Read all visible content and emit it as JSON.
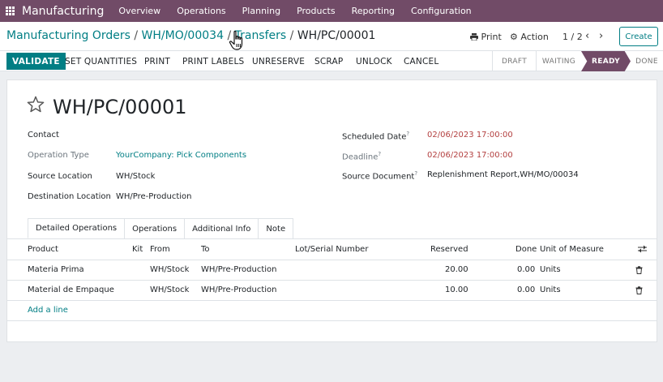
{
  "navbar": {
    "brand": "Manufacturing",
    "menu": [
      "Overview",
      "Operations",
      "Planning",
      "Products",
      "Reporting",
      "Configuration"
    ]
  },
  "breadcrumb": {
    "items": [
      "Manufacturing Orders",
      "WH/MO/00034",
      "Transfers"
    ],
    "current": "WH/PC/00001",
    "separator": "/"
  },
  "control": {
    "print_label": "Print",
    "action_label": "Action",
    "pager": "1 / 2",
    "create_label": "Create"
  },
  "actions": {
    "validate": "VALIDATE",
    "set_quantities": "SET QUANTITIES",
    "print": "PRINT",
    "print_labels": "PRINT LABELS",
    "unreserve": "UNRESERVE",
    "scrap": "SCRAP",
    "unlock": "UNLOCK",
    "cancel": "CANCEL"
  },
  "stages": [
    "DRAFT",
    "WAITING",
    "READY",
    "DONE"
  ],
  "active_stage": "READY",
  "record": {
    "name": "WH/PC/00001",
    "left_fields": [
      {
        "label": "Contact",
        "value": ""
      },
      {
        "label": "Operation Type",
        "value": "YourCompany: Pick Components"
      },
      {
        "label": "Source Location",
        "value": "WH/Stock"
      },
      {
        "label": "Destination Location",
        "value": "WH/Pre-Production"
      }
    ],
    "right_fields": [
      {
        "label": "Scheduled Date",
        "value": "02/06/2023 17:00:00"
      },
      {
        "label": "Deadline",
        "value": "02/06/2023 17:00:00"
      },
      {
        "label": "Source Document",
        "value": "Replenishment Report,WH/MO/00034"
      }
    ]
  },
  "tabs": [
    "Detailed Operations",
    "Operations",
    "Additional Info",
    "Note"
  ],
  "table": {
    "headers": {
      "product": "Product",
      "kit": "Kit",
      "from": "From",
      "to": "To",
      "lot": "Lot/Serial Number",
      "reserved": "Reserved",
      "done": "Done",
      "uom": "Unit of Measure"
    },
    "rows": [
      {
        "product": "Materia Prima",
        "from": "WH/Stock",
        "to": "WH/Pre-Production",
        "reserved": "20.00",
        "done": "0.00",
        "uom": "Units"
      },
      {
        "product": "Material de Empaque",
        "from": "WH/Stock",
        "to": "WH/Pre-Production",
        "reserved": "10.00",
        "done": "0.00",
        "uom": "Units"
      }
    ],
    "add_line": "Add a line"
  },
  "colors": {
    "brand": "#714b67",
    "accent": "#017e84",
    "date_red": "#b34040"
  },
  "icons": [
    "apps-grid-icon",
    "print-icon",
    "gear-icon",
    "chevron-left-icon",
    "chevron-right-icon",
    "star-icon",
    "trash-icon",
    "adjust-columns-icon",
    "hand-cursor-icon"
  ]
}
